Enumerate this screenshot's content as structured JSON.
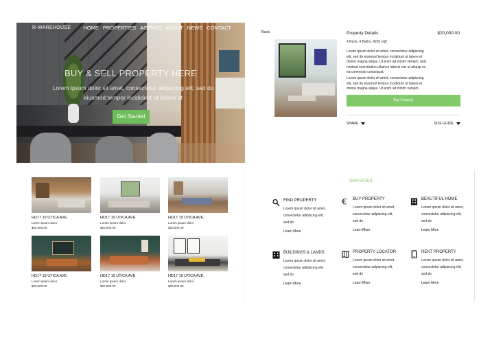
{
  "hero": {
    "brand": "R-WAREHOUSE",
    "nav": [
      "HOME",
      "PROPERTIES",
      "AGENTS",
      "ABOUT",
      "NEWS",
      "CONTACT"
    ],
    "headline": "BUY & SELL PROPERTY HERE",
    "subtext": "Lorem ipsum dolor sit amet, consectetur adipiscing elit, sed do eiusmod tempor incididunt ut labore et",
    "cta": "Get Started"
  },
  "detail": {
    "back": "Back",
    "title": "Property Details",
    "price": "$20,000.00",
    "specs": "4 Beds, 4 Baths, 4250 sqft",
    "para1": "Lorem ipsum dolor sit amet, consectetur adipiscing elit, sed do eiusmod tempor incididunt ut labore et dolore magna aliqua. Ut enim ad minim veniam, quis nostrud exercitation ullamco laboris nisi ut aliquip ex ea commodo consequat.",
    "para2": "Lorem ipsum dolor sit amet, consectetur adipiscing elit, sed do eiusmod tempor incididunt ut labore et dolore magna aliqua. Ut enim ad minim veniam.",
    "buy": "Buy Property",
    "share": "SHARE",
    "size_guide": "SIZE GUIDE"
  },
  "listings": [
    {
      "name": "HD17 19 UTICA AVE.",
      "line": "Lorem ipsum dolor",
      "price": "$20,000.00"
    },
    {
      "name": "HD17 19 UTICA AVE.",
      "line": "Lorem ipsum dolor",
      "price": "$20,000.00"
    },
    {
      "name": "HD17 19 UTICA AVE.",
      "line": "Lorem ipsum dolor",
      "price": "$20,000.00"
    },
    {
      "name": "HD17 19 UTICA AVE.",
      "line": "Lorem ipsum dolor",
      "price": "$20,000.00"
    },
    {
      "name": "HD17 19 UTICA AVE.",
      "line": "Lorem ipsum dolor",
      "price": "$20,000.00"
    },
    {
      "name": "HD17 19 UTICA AVE.",
      "line": "Lorem ipsum dolor",
      "price": "$20,000.00"
    }
  ],
  "services": {
    "heading": "SERVICES",
    "items": [
      {
        "title": "FIND PROPERTY",
        "icon": "search-icon",
        "desc": "Lorem ipsum dolor sit amet, consectetur adipiscing elit, sed do",
        "link": "Learn More"
      },
      {
        "title": "BUY PROPERTY",
        "icon": "euro-icon",
        "desc": "Lorem ipsum dolor sit amet, consectetur adipiscing elit, sed do",
        "link": "Learn More"
      },
      {
        "title": "BEAUTIFUL HOME",
        "icon": "building-icon",
        "desc": "Lorem ipsum dolor sit amet, consectetur adipiscing elit, sed do",
        "link": "Learn More"
      },
      {
        "title": "BUILDINGS & LANDS",
        "icon": "office-building-icon",
        "desc": "Lorem ipsum dolor sit amet, consectetur adipiscing elit, sed do",
        "link": "Learn More"
      },
      {
        "title": "PROPERTY LOCATOR",
        "icon": "map-icon",
        "desc": "Lorem ipsum dolor sit amet, consectetur adipiscing elit, sed do",
        "link": "Learn More"
      },
      {
        "title": "RENT PROPERTY",
        "icon": "phone-icon",
        "desc": "Lorem ipsum dolor sit amet, consectetur adipiscing elit, sed do",
        "link": "Learn More"
      }
    ]
  },
  "colors": {
    "accent_green": "#6ebd5a",
    "services_heading": "#79c35f"
  }
}
